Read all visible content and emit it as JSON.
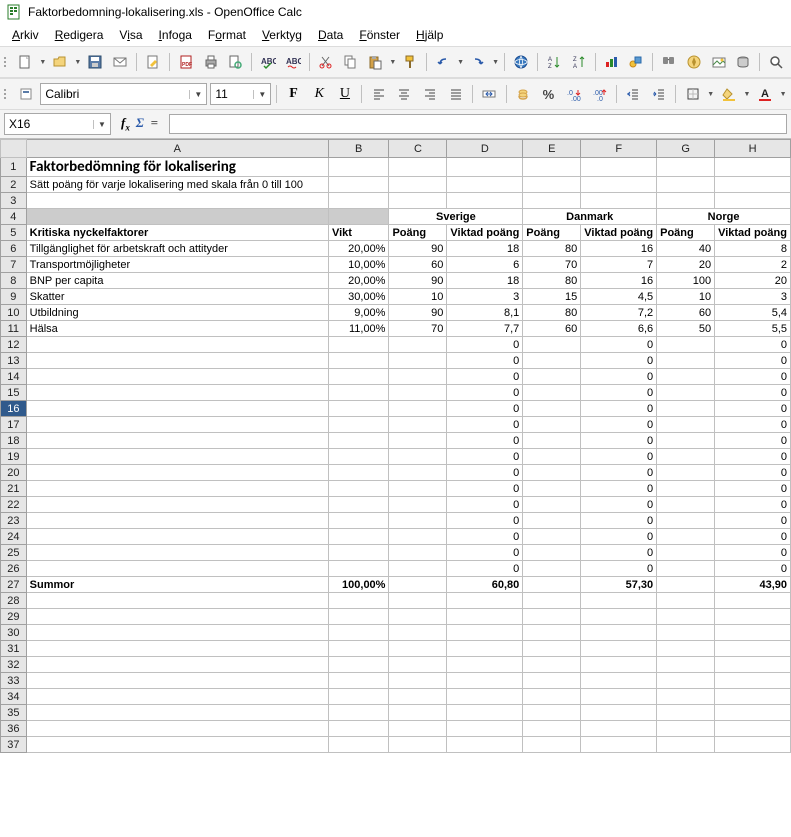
{
  "window": {
    "title": "Faktorbedomning-lokalisering.xls - OpenOffice Calc"
  },
  "menubar": [
    "Arkiv",
    "Redigera",
    "Visa",
    "Infoga",
    "Format",
    "Verktyg",
    "Data",
    "Fönster",
    "Hjälp"
  ],
  "cellref": {
    "value": "X16"
  },
  "font": {
    "name": "Calibri",
    "size": "11"
  },
  "columns": [
    "A",
    "B",
    "C",
    "D",
    "E",
    "F",
    "G",
    "H"
  ],
  "sheet": {
    "title": "Faktorbedömning för lokalisering",
    "subtitle": "Sätt poäng för varje lokalisering med skala från 0 till 100",
    "group_headers": [
      "Sverige",
      "Danmark",
      "Norge"
    ],
    "col_headers": {
      "factors": "Kritiska nyckelfaktorer",
      "weight": "Vikt",
      "score": "Poäng",
      "weighted": "Viktad poäng"
    },
    "rows": [
      {
        "factor": "Tillgänglighet för arbetskraft och attityder",
        "weight": "20,00%",
        "c": "90",
        "d": "18",
        "e": "80",
        "f": "16",
        "g": "40",
        "h": "8"
      },
      {
        "factor": "Transportmöjligheter",
        "weight": "10,00%",
        "c": "60",
        "d": "6",
        "e": "70",
        "f": "7",
        "g": "20",
        "h": "2"
      },
      {
        "factor": "BNP per capita",
        "weight": "20,00%",
        "c": "90",
        "d": "18",
        "e": "80",
        "f": "16",
        "g": "100",
        "h": "20"
      },
      {
        "factor": "Skatter",
        "weight": "30,00%",
        "c": "10",
        "d": "3",
        "e": "15",
        "f": "4,5",
        "g": "10",
        "h": "3"
      },
      {
        "factor": "Utbildning",
        "weight": "9,00%",
        "c": "90",
        "d": "8,1",
        "e": "80",
        "f": "7,2",
        "g": "60",
        "h": "5,4"
      },
      {
        "factor": "Hälsa",
        "weight": "11,00%",
        "c": "70",
        "d": "7,7",
        "e": "60",
        "f": "6,6",
        "g": "50",
        "h": "5,5"
      }
    ],
    "zero": "0",
    "sum": {
      "label": "Summor",
      "weight": "100,00%",
      "d": "60,80",
      "f": "57,30",
      "h": "43,90"
    },
    "selected_row": 16,
    "total_rows": 37
  }
}
